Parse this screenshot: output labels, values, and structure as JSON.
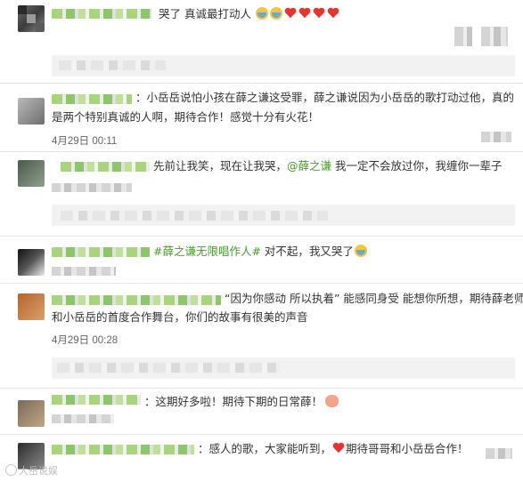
{
  "comments": [
    {
      "text": "哭了 真诚最打动人",
      "emojis": [
        "cry",
        "cry",
        "heart",
        "heart",
        "heart",
        "heart"
      ]
    },
    {
      "text_line1": "：小岳岳说怕小孩在薛之谦这受罪，薛之谦说因为小岳岳的歌打动过他，真的",
      "text_line2": "是两个特别真诚的人啊，期待合作！感觉十分有火花！",
      "date": "4月29日 00:11"
    },
    {
      "text_before": "先前让我笑，现在让我哭，",
      "mention": "@薛之谦",
      "text_after": " 我一定不会放过你，我缠你一辈子"
    },
    {
      "hashtag": "#薛之谦无限唱作人#",
      "text": " 对不起，我又哭了",
      "emojis": [
        "cry"
      ]
    },
    {
      "text_line1": "“因为你感动 所以执着” 能感同身受 能想你所想，期待薛老师",
      "text_line2": "和小岳岳的首度合作舞台，你们的故事有很美的声音",
      "date": "4月29日 00:28"
    },
    {
      "text": "：这期好多啦！期待下期的日常薛！",
      "emojis": [
        "pig"
      ]
    },
    {
      "text_before": "：感人的歌，大家能听到，",
      "text_after": "期待哥哥和小岳岳合作！",
      "emojis": [
        "heart"
      ]
    }
  ],
  "watermark": "大岳说娱",
  "colors": {
    "link": "#4b9b2e",
    "heart": "#e8332f",
    "text": "#333333",
    "date": "#666666"
  }
}
